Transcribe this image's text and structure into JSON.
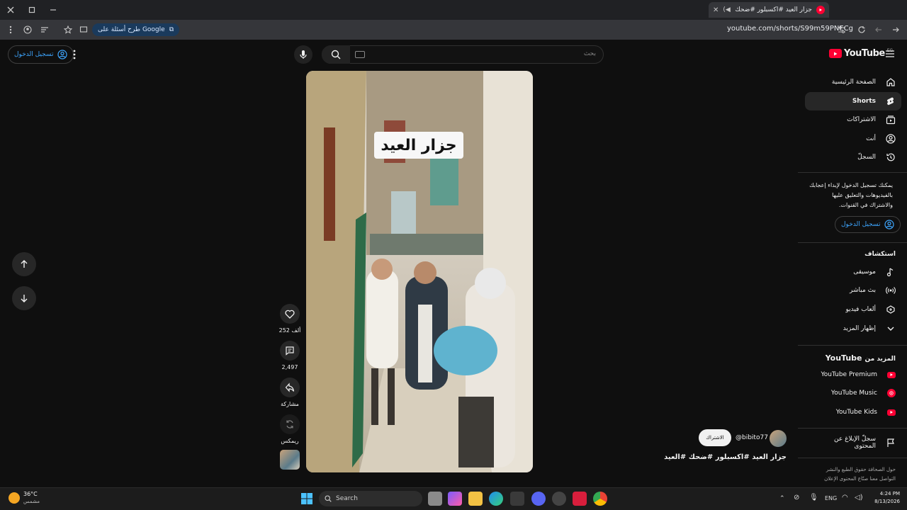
{
  "browser": {
    "tab_title": "جزار العيد #اكسبلور #ضحك #",
    "url": "youtube.com/shorts/S99m59PNECg",
    "google_chip": "طرح أسئلة على Google"
  },
  "header": {
    "logo_text": "YouTube",
    "country_code": "EG",
    "search_placeholder": "بحث",
    "signin_label": "تسجيل الدخول"
  },
  "sidebar": {
    "items": [
      {
        "label": "الصفحة الرئيسية",
        "icon": "home-icon"
      },
      {
        "label": "Shorts",
        "icon": "shorts-icon",
        "active": true
      },
      {
        "label": "الاشتراكات",
        "icon": "subscriptions-icon"
      },
      {
        "label": "أنت",
        "icon": "you-icon"
      },
      {
        "label": "السجلّ",
        "icon": "history-icon"
      }
    ],
    "signin_prompt": "يمكنك تسجيل الدخول لإبداء إعجابك بالفيديوهات والتعليق عليها والاشتراك في القنوات.",
    "signin_label": "تسجيل الدخول",
    "explore_title": "استكشاف",
    "explore_items": [
      {
        "label": "موسيقى",
        "icon": "music-icon"
      },
      {
        "label": "بث مباشر",
        "icon": "live-icon"
      },
      {
        "label": "ألعاب فيديو",
        "icon": "gaming-icon"
      },
      {
        "label": "إظهار المزيد",
        "icon": "chevron-down-icon"
      }
    ],
    "more_from_title": "المزيد من",
    "more_from_brand": "YouTube",
    "more_items": [
      {
        "label": "YouTube Premium"
      },
      {
        "label": "YouTube Music"
      },
      {
        "label": "YouTube Kids"
      }
    ],
    "report_label": "سجلّ الإبلاغ عن المحتوى",
    "footer_line1": "حول  الصحافة  حقوق الطبع والنشر",
    "footer_line2": "التواصل معنا  صنّاع المحتوى  الإعلان"
  },
  "short": {
    "caption": "جزار العيد",
    "likes": "252 ألف",
    "comments": "2,497",
    "share_label": "مشاركة",
    "remix_label": "ريمكس",
    "channel": "@bibito77",
    "subscribe_label": "الاشتراك",
    "title": "جزار العيد #اكسبلور #ضحك #العيد"
  },
  "taskbar": {
    "weather_temp": "36°C",
    "weather_desc": "مشمس",
    "search_label": "Search",
    "lang": "ENG",
    "time": "4:24 PM",
    "date": "8/13/2026"
  },
  "colors": {
    "background": "#0f0f0f",
    "accent_red": "#ff0033",
    "link_blue": "#3ea6ff",
    "surface": "#272727"
  }
}
